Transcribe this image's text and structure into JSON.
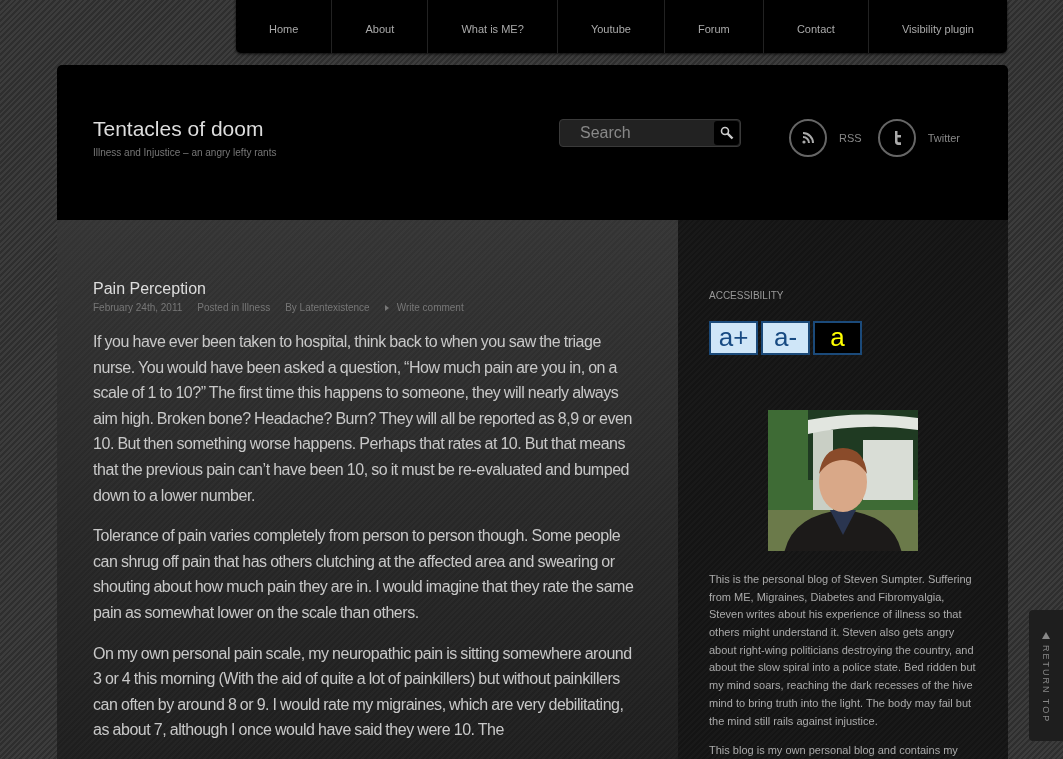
{
  "nav": [
    {
      "label": "Home"
    },
    {
      "label": "About"
    },
    {
      "label": "What is ME?"
    },
    {
      "label": "Youtube"
    },
    {
      "label": "Forum"
    },
    {
      "label": "Contact"
    },
    {
      "label": "Visibility plugin"
    }
  ],
  "header": {
    "title": "Tentacles of doom",
    "tagline": "Illness and Injustice – an angry lefty rants",
    "search": {
      "placeholder": "Search"
    },
    "social": [
      {
        "kind": "rss",
        "label": "RSS"
      },
      {
        "kind": "twitter",
        "label": "Twitter"
      }
    ]
  },
  "post": {
    "title": "Pain Perception",
    "meta": [
      {
        "kind": "plain",
        "text": "February 24th, 2011"
      },
      {
        "kind": "plain",
        "text": "Posted in Illness"
      },
      {
        "kind": "plain",
        "text": "By Latentexistence"
      },
      {
        "kind": "arrow",
        "text": "Write comment"
      }
    ],
    "paragraphs": [
      "If you have ever been taken to hospital, think back to when you saw the triage nurse. You would have been asked a question, “How much pain are you in, on a scale of 1 to 10?” The first time this happens to someone, they will nearly always aim high. Broken bone? Headache? Burn? They will all be reported as 8,9 or even 10. But then something worse happens. Perhaps that rates at 10. But that means that the previous pain can’t have been 10, so it must be re-evaluated and bumped down to a lower number.",
      "Tolerance of pain varies completely from person to person though. Some people can shrug off pain that has others clutching at the affected area and swearing or shouting about how much pain they are in. I would imagine that they rate the same pain as somewhat lower on the scale than others.",
      "On my own personal pain scale, my neuropathic pain is sitting somewhere around 3 or 4 this morning (With the aid of quite a lot of painkillers) but without painkillers can often by around 8 or 9. I would rate my migraines, which are very debilitating, as about 7, although I once would have said they were 10. The"
    ]
  },
  "sidebar": {
    "heading": "ACCESSIBILITY",
    "buttons": [
      {
        "kind": "light",
        "label": "a+"
      },
      {
        "kind": "light",
        "label": "a-"
      },
      {
        "kind": "dark",
        "label": "a"
      }
    ],
    "photo": {
      "kind": "picture"
    },
    "paragraphs": [
      "This is the personal blog of Steven Sumpter. Suffering from ME, Migraines, Diabetes and Fibromyalgia, Steven writes about his experience of illness so that others might understand it. Steven also gets angry about right-wing politicians destroying the country, and about the slow spiral into a police state. Bed ridden but my mind soars, reaching the dark recesses of the hive mind to bring truth into the light. The body may fail but the mind still rails against injustice.",
      "This blog is my own personal blog and contains my"
    ]
  },
  "return_top": {
    "label": "RETURN TOP"
  }
}
